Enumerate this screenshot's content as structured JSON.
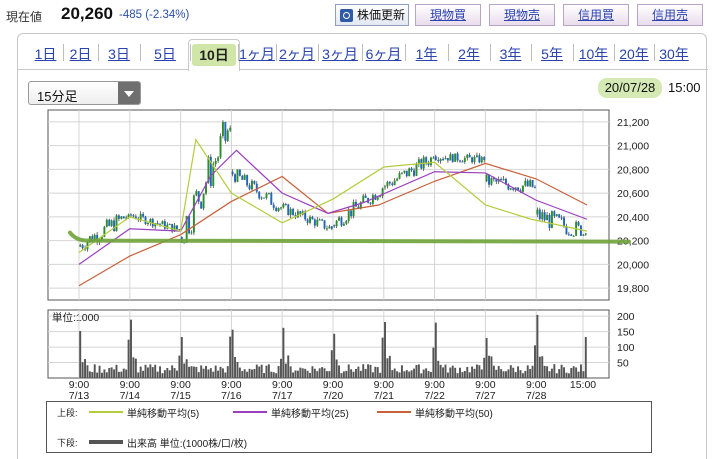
{
  "quote": {
    "price_label": "現在値",
    "price": "20,260",
    "change": "-485 (-2.34%)"
  },
  "buttons": {
    "refresh": "株価更新",
    "spot_buy": "現物買",
    "spot_sell": "現物売",
    "margin_buy": "信用買",
    "margin_sell": "信用売"
  },
  "tabs": [
    {
      "label": "1日"
    },
    {
      "label": "2日"
    },
    {
      "label": "3日"
    },
    {
      "label": "5日"
    },
    {
      "label": "10日",
      "active": true
    },
    {
      "label": "1ヶ月"
    },
    {
      "label": "2ヶ月"
    },
    {
      "label": "3ヶ月"
    },
    {
      "label": "6ヶ月"
    },
    {
      "label": "1年"
    },
    {
      "label": "2年"
    },
    {
      "label": "3年"
    },
    {
      "label": "5年"
    },
    {
      "label": "10年"
    },
    {
      "label": "20年"
    },
    {
      "label": "30年"
    }
  ],
  "interval_select": {
    "value": "15分足"
  },
  "datestamp": {
    "date": "20/07/28",
    "time": "15:00"
  },
  "colors": {
    "ma5": "#b5cc3c",
    "ma25": "#9b3fbf",
    "ma50": "#c8603a",
    "candle_up": "#2e8b2e",
    "candle_down": "#2266bb",
    "volume": "#555555",
    "support_line": "#6fa33a",
    "highlight": "#cfe6a8"
  },
  "chart_data": {
    "type": "candlestick",
    "x_ticks": [
      {
        "time": "9:00",
        "date": "7/13"
      },
      {
        "time": "9:00",
        "date": "7/14"
      },
      {
        "time": "9:00",
        "date": "7/15"
      },
      {
        "time": "9:00",
        "date": "7/16"
      },
      {
        "time": "9:00",
        "date": "7/17"
      },
      {
        "time": "9:00",
        "date": "7/20"
      },
      {
        "time": "9:00",
        "date": "7/21"
      },
      {
        "time": "9:00",
        "date": "7/22"
      },
      {
        "time": "9:00",
        "date": "7/27"
      },
      {
        "time": "9:00",
        "date": "7/28"
      },
      {
        "time": "15:00",
        "date": ""
      }
    ],
    "price_ticks": [
      "21,200",
      "21,000",
      "20,800",
      "20,600",
      "20,400",
      "20,200",
      "20,000",
      "19,800"
    ],
    "price_ylim": [
      19700,
      21300
    ],
    "volume_unit_label": "単位:1000",
    "volume_ticks": [
      "200",
      "150",
      "100",
      "50"
    ],
    "volume_ylim": [
      0,
      220
    ],
    "bars_per_day": 21,
    "days": [
      {
        "date": "7/13",
        "open": 20150,
        "close": 20420,
        "low": 20080,
        "high": 20500
      },
      {
        "date": "7/14",
        "open": 20420,
        "close": 20290,
        "low": 20230,
        "high": 20450
      },
      {
        "date": "7/15",
        "open": 20230,
        "close": 21150,
        "low": 20180,
        "high": 21230
      },
      {
        "date": "7/16",
        "open": 20780,
        "close": 20480,
        "low": 20440,
        "high": 20800
      },
      {
        "date": "7/17",
        "open": 20480,
        "close": 20300,
        "low": 20250,
        "high": 20520
      },
      {
        "date": "7/20",
        "open": 20330,
        "close": 20640,
        "low": 20300,
        "high": 20660
      },
      {
        "date": "7/21",
        "open": 20650,
        "close": 20900,
        "low": 20620,
        "high": 20970
      },
      {
        "date": "7/22",
        "open": 20910,
        "close": 20880,
        "low": 20820,
        "high": 21030
      },
      {
        "date": "7/27",
        "open": 20700,
        "close": 20650,
        "low": 20380,
        "high": 20760
      },
      {
        "date": "7/28",
        "open": 20420,
        "close": 20260,
        "low": 20240,
        "high": 20720
      }
    ],
    "ma5": [
      [
        0,
        20100
      ],
      [
        1,
        20400
      ],
      [
        2,
        20280
      ],
      [
        2.3,
        21050
      ],
      [
        3,
        20600
      ],
      [
        4,
        20350
      ],
      [
        5,
        20550
      ],
      [
        6,
        20820
      ],
      [
        7,
        20860
      ],
      [
        8,
        20500
      ],
      [
        8.9,
        20380
      ],
      [
        10,
        20280
      ]
    ],
    "ma25": [
      [
        0,
        20000
      ],
      [
        1,
        20300
      ],
      [
        2,
        20280
      ],
      [
        2.6,
        20750
      ],
      [
        3.1,
        20960
      ],
      [
        4,
        20600
      ],
      [
        4.9,
        20430
      ],
      [
        5.6,
        20520
      ],
      [
        7,
        20780
      ],
      [
        8,
        20770
      ],
      [
        9,
        20540
      ],
      [
        10,
        20380
      ]
    ],
    "ma50": [
      [
        0,
        19820
      ],
      [
        1,
        20070
      ],
      [
        2,
        20250
      ],
      [
        3,
        20530
      ],
      [
        4,
        20740
      ],
      [
        4.9,
        20430
      ],
      [
        5.9,
        20500
      ],
      [
        7,
        20700
      ],
      [
        8,
        20850
      ],
      [
        9,
        20720
      ],
      [
        10,
        20500
      ]
    ],
    "support_level": 20200,
    "volume_peaks": [
      30,
      190,
      120,
      60,
      210,
      150,
      45,
      200,
      150,
      60,
      200,
      130,
      45,
      130,
      100,
      50,
      150,
      90,
      45,
      160,
      110,
      40,
      170,
      80,
      40,
      120,
      150
    ],
    "legend": {
      "upper_tag": "上段:",
      "lower_tag": "下段:",
      "ma5": "単純移動平均(5)",
      "ma25": "単純移動平均(25)",
      "ma50": "単純移動平均(50)",
      "volume": "出来高 単位:(1000株/口/枚)"
    }
  }
}
